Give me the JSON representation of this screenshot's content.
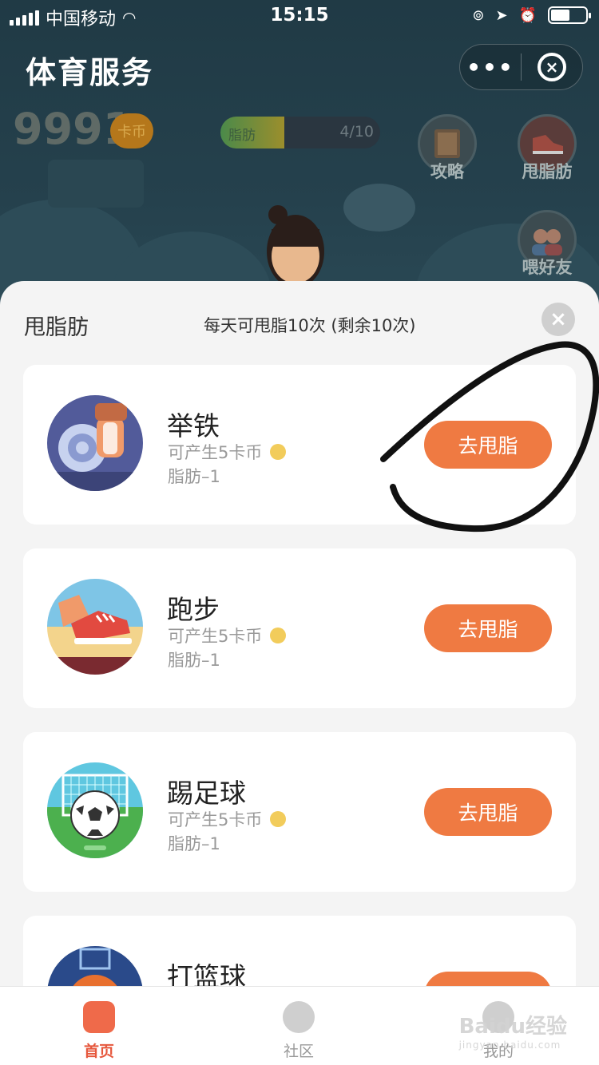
{
  "status": {
    "carrier": "中国移动",
    "time": "15:15"
  },
  "header": {
    "title": "体育服务",
    "more_icon": "more-dots-icon",
    "close_icon": "miniapp-close-icon"
  },
  "game": {
    "coins": "9991",
    "coin_unit": "卡币",
    "fat_label": "脂肪",
    "fat_count": "4/10",
    "fat_progress": 0.4,
    "side_buttons": [
      {
        "label": "攻略",
        "icon": "book-icon"
      },
      {
        "label": "甩脂肪",
        "icon": "shoe-icon"
      },
      {
        "label": "喂好友",
        "icon": "friends-icon"
      }
    ]
  },
  "panel": {
    "title": "甩脂肪",
    "subtitle": "每天可甩脂10次 (剩余10次)",
    "activities": [
      {
        "name": "举铁",
        "reward": "可产生5卡币",
        "cost": "脂肪–1",
        "action": "去甩脂",
        "icon": "weightlifting-icon"
      },
      {
        "name": "跑步",
        "reward": "可产生5卡币",
        "cost": "脂肪–1",
        "action": "去甩脂",
        "icon": "running-shoe-icon"
      },
      {
        "name": "踢足球",
        "reward": "可产生5卡币",
        "cost": "脂肪–1",
        "action": "去甩脂",
        "icon": "soccer-icon"
      },
      {
        "name": "打篮球",
        "reward": "",
        "cost": "",
        "action": "去甩脂",
        "icon": "basketball-icon"
      }
    ]
  },
  "tabbar": {
    "tabs": [
      {
        "label": "首页",
        "icon": "home-icon",
        "active": true
      },
      {
        "label": "社区",
        "icon": "community-icon",
        "active": false
      },
      {
        "label": "我的",
        "icon": "profile-icon",
        "active": false
      }
    ]
  },
  "watermark": {
    "text": "Baidu经验",
    "sub": "jingyan.baidu.com"
  },
  "colors": {
    "accent": "#ef7a42",
    "tab_active": "#e6573c",
    "scene_bg": "#203a45"
  }
}
